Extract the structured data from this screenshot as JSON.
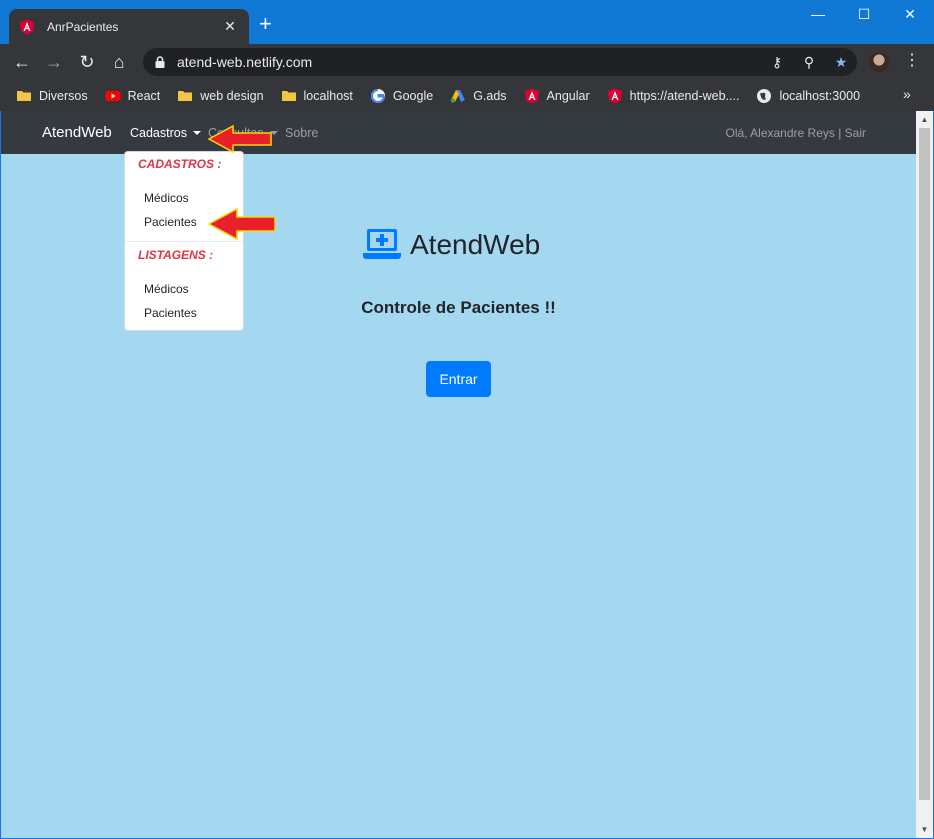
{
  "browser": {
    "tab_title": "AnrPacientes",
    "tab_close": "✕",
    "new_tab": "+",
    "minimize": "—",
    "maximize": "☐",
    "close": "✕",
    "url": "atend-web.netlify.com",
    "back": "←",
    "forward": "→",
    "reload": "↻",
    "home": "⌂",
    "key": "⚷",
    "zoom": "⚲",
    "star": "★",
    "menu": "⋮",
    "bookmarks_more": "»",
    "bookmarks": [
      {
        "label": "Diversos",
        "icon": "folder-icon"
      },
      {
        "label": "React",
        "icon": "youtube-icon"
      },
      {
        "label": "web design",
        "icon": "folder-icon"
      },
      {
        "label": "localhost",
        "icon": "folder-icon"
      },
      {
        "label": "Google",
        "icon": "google-icon"
      },
      {
        "label": "G.ads",
        "icon": "google-ads-icon"
      },
      {
        "label": "Angular",
        "icon": "angular-icon"
      },
      {
        "label": "https://atend-web....",
        "icon": "angular-icon"
      },
      {
        "label": "localhost:3000",
        "icon": "globe-icon"
      }
    ]
  },
  "navbar": {
    "brand": "AtendWeb",
    "cadastros": "Cadastros",
    "consultas": "Consultas",
    "sobre": "Sobre",
    "user": "Olá, Alexandre Reys | Sair"
  },
  "dropdown": {
    "header_cadastros": "CADASTROS :",
    "item_medicos": "Médicos",
    "item_pacientes": "Pacientes",
    "header_listagens": "LISTAGENS :",
    "list_medicos": "Médicos",
    "list_pacientes": "Pacientes"
  },
  "main": {
    "title": "AtendWeb",
    "subtitle": "Controle de Pacientes !!",
    "enter_button": "Entrar"
  },
  "colors": {
    "page_bg": "#a3d8f0",
    "navbar_bg": "#343a40",
    "primary": "#007bff",
    "danger": "#dc3545",
    "arrow": "#e8202a"
  },
  "scrollbar": {
    "up": "▲",
    "down": "▼"
  }
}
